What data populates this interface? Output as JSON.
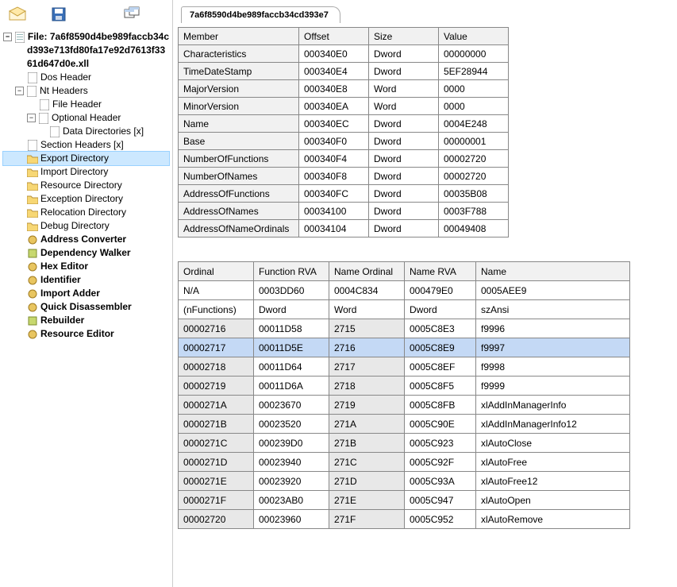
{
  "tab": "7a6f8590d4be989faccb34cd393e7",
  "file_line1": "File: 7a6f8590d4be989faccb34c",
  "file_line2": "d393e713fd80fa17e92d7613f33",
  "file_line3": "61d647d0e.xll",
  "tree": {
    "dos_header": "Dos Header",
    "nt_headers": "Nt Headers",
    "file_header": "File Header",
    "optional_header": "Optional Header",
    "data_directories": "Data Directories [x]",
    "section_headers": "Section Headers [x]",
    "export_directory": "Export Directory",
    "import_directory": "Import Directory",
    "resource_directory": "Resource Directory",
    "exception_directory": "Exception Directory",
    "relocation_directory": "Relocation Directory",
    "debug_directory": "Debug Directory",
    "address_converter": "Address Converter",
    "dependency_walker": "Dependency Walker",
    "hex_editor": "Hex Editor",
    "identifier": "Identifier",
    "import_adder": "Import Adder",
    "quick_disassembler": "Quick Disassembler",
    "rebuilder": "Rebuilder",
    "resource_editor": "Resource Editor"
  },
  "members_table": {
    "headers": [
      "Member",
      "Offset",
      "Size",
      "Value"
    ],
    "rows": [
      [
        "Characteristics",
        "000340E0",
        "Dword",
        "00000000"
      ],
      [
        "TimeDateStamp",
        "000340E4",
        "Dword",
        "5EF28944"
      ],
      [
        "MajorVersion",
        "000340E8",
        "Word",
        "0000"
      ],
      [
        "MinorVersion",
        "000340EA",
        "Word",
        "0000"
      ],
      [
        "Name",
        "000340EC",
        "Dword",
        "0004E248"
      ],
      [
        "Base",
        "000340F0",
        "Dword",
        "00000001"
      ],
      [
        "NumberOfFunctions",
        "000340F4",
        "Dword",
        "00002720"
      ],
      [
        "NumberOfNames",
        "000340F8",
        "Dword",
        "00002720"
      ],
      [
        "AddressOfFunctions",
        "000340FC",
        "Dword",
        "00035B08"
      ],
      [
        "AddressOfNames",
        "00034100",
        "Dword",
        "0003F788"
      ],
      [
        "AddressOfNameOrdinals",
        "00034104",
        "Dword",
        "00049408"
      ]
    ]
  },
  "details_table": {
    "headers": [
      "Ordinal",
      "Function RVA",
      "Name Ordinal",
      "Name RVA",
      "Name"
    ],
    "row0": [
      "N/A",
      "0003DD60",
      "0004C834",
      "000479E0",
      "0005AEE9"
    ],
    "row1": [
      "(nFunctions)",
      "Dword",
      "Word",
      "Dword",
      "szAnsi"
    ],
    "rows": [
      [
        "00002716",
        "00011D58",
        "2715",
        "0005C8E3",
        "f9996"
      ],
      [
        "00002717",
        "00011D5E",
        "2716",
        "0005C8E9",
        "f9997"
      ],
      [
        "00002718",
        "00011D64",
        "2717",
        "0005C8EF",
        "f9998"
      ],
      [
        "00002719",
        "00011D6A",
        "2718",
        "0005C8F5",
        "f9999"
      ],
      [
        "0000271A",
        "00023670",
        "2719",
        "0005C8FB",
        "xlAddInManagerInfo"
      ],
      [
        "0000271B",
        "00023520",
        "271A",
        "0005C90E",
        "xlAddInManagerInfo12"
      ],
      [
        "0000271C",
        "000239D0",
        "271B",
        "0005C923",
        "xlAutoClose"
      ],
      [
        "0000271D",
        "00023940",
        "271C",
        "0005C92F",
        "xlAutoFree"
      ],
      [
        "0000271E",
        "00023920",
        "271D",
        "0005C93A",
        "xlAutoFree12"
      ],
      [
        "0000271F",
        "00023AB0",
        "271E",
        "0005C947",
        "xlAutoOpen"
      ],
      [
        "00002720",
        "00023960",
        "271F",
        "0005C952",
        "xlAutoRemove"
      ]
    ],
    "selected_index": 1
  }
}
